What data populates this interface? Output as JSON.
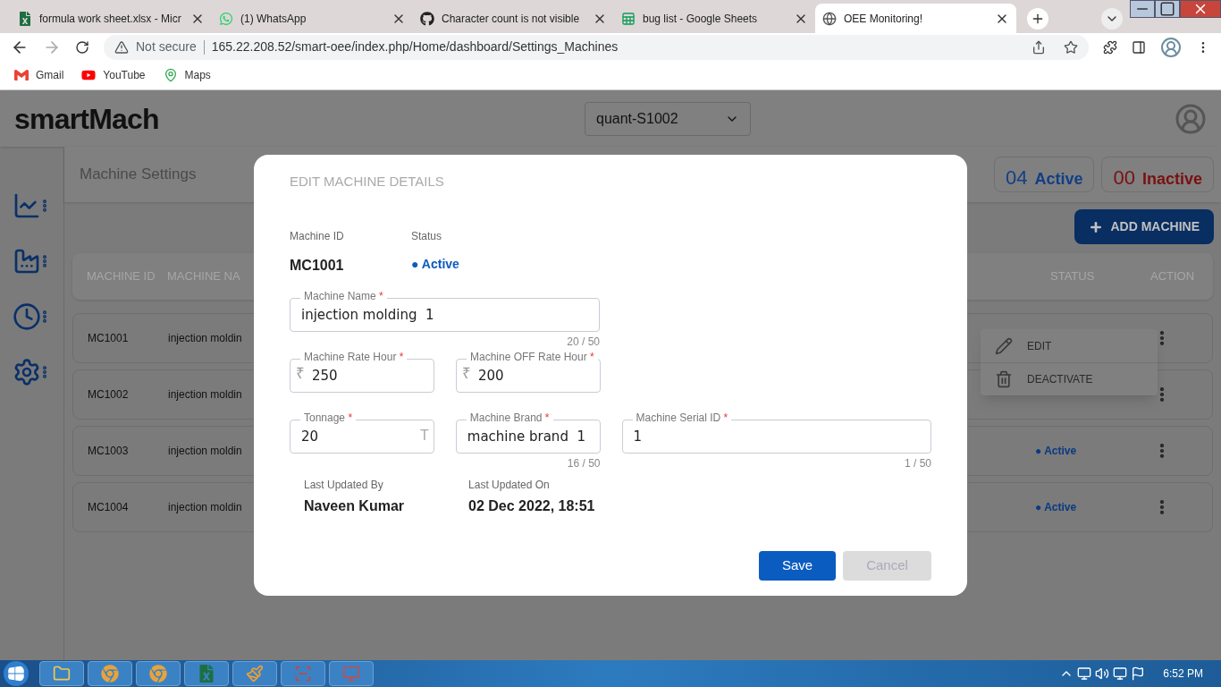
{
  "browser": {
    "tabs": [
      {
        "title": "formula work sheet.xlsx - Micr",
        "selected": false
      },
      {
        "title": "(1) WhatsApp",
        "selected": false
      },
      {
        "title": "Character count is not visible",
        "selected": false
      },
      {
        "title": "bug list - Google Sheets",
        "selected": false
      },
      {
        "title": "OEE Monitoring!",
        "selected": true
      }
    ],
    "security": "Not secure",
    "url": "165.22.208.52/smart-oee/index.php/Home/dashboard/Settings_Machines",
    "bookmarks": [
      "Gmail",
      "YouTube",
      "Maps"
    ]
  },
  "app": {
    "logo": "smartMach",
    "plant_selector": "quant-S1002",
    "page_title": "Machine Settings",
    "counters": [
      {
        "count": "04",
        "label": "Active",
        "kind": "active"
      },
      {
        "count": "00",
        "label": "Inactive",
        "kind": "inactive"
      }
    ],
    "add_button": "ADD MACHINE",
    "table": {
      "columns": [
        "MACHINE ID",
        "MACHINE NA",
        "STATUS",
        "ACTION"
      ],
      "rows": [
        {
          "id": "MC1001",
          "name": "injection moldin"
        },
        {
          "id": "MC1002",
          "name": "injection moldin"
        },
        {
          "id": "MC1003",
          "name": "injection moldin",
          "status": "● Active"
        },
        {
          "id": "MC1004",
          "name": "injection moldin",
          "status": "● Active"
        }
      ]
    },
    "row_menu": [
      {
        "label": "EDIT",
        "kind": "edit"
      },
      {
        "label": "DEACTIVATE",
        "kind": "delete"
      }
    ]
  },
  "dialog": {
    "title": "EDIT MACHINE DETAILS",
    "machine_id": {
      "label": "Machine ID",
      "value": "MC1001"
    },
    "status": {
      "label": "Status",
      "value": "● Active"
    },
    "field_rows": [
      [
        {
          "label": "Machine Name",
          "required_mark": "*",
          "value": "injection molding  1",
          "counter": "20 / 50"
        }
      ],
      [
        {
          "label": "Machine Rate Hour",
          "required_mark": "*",
          "value": "250",
          "prefix": "₹"
        },
        {
          "label": "Machine OFF Rate Hour",
          "required_mark": "*",
          "value": "200",
          "prefix": "₹"
        }
      ],
      [
        {
          "label": "Tonnage",
          "required_mark": "*",
          "value": "20",
          "suffix": "T"
        },
        {
          "label": "Machine Brand",
          "required_mark": "*",
          "value": "machine brand  1",
          "counter": "16 / 50"
        },
        {
          "label": "Machine Serial ID",
          "required_mark": "*",
          "value": "1",
          "counter": "1 / 50"
        }
      ]
    ],
    "updated": [
      {
        "label": "Last Updated By",
        "value": "Naveen Kumar"
      },
      {
        "label": "Last Updated On",
        "value": "02 Dec 2022, 18:51"
      }
    ],
    "buttons": [
      {
        "label": "Save",
        "disabled": false
      },
      {
        "label": "Cancel",
        "disabled": true
      }
    ]
  },
  "taskbar": {
    "clock": "6:52 PM"
  }
}
